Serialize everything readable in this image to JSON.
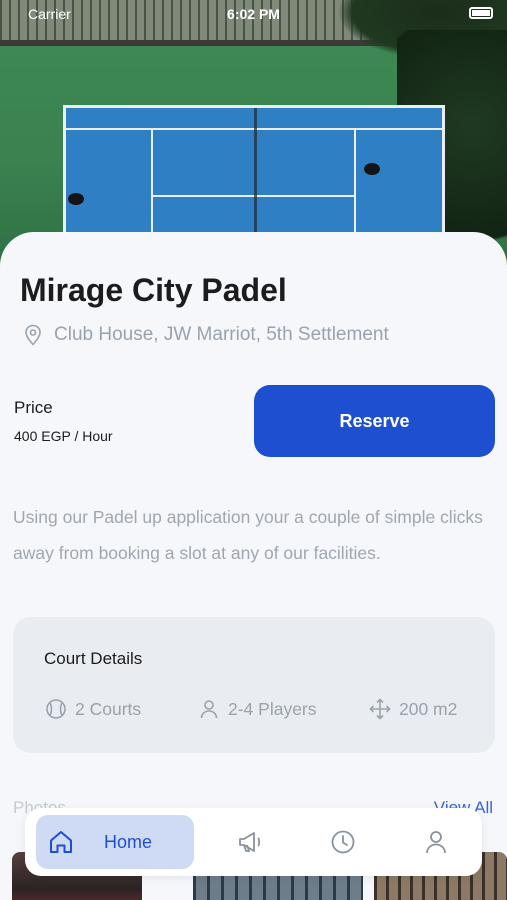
{
  "status_bar": {
    "carrier": "Carrier",
    "time": "6:02 PM"
  },
  "venue": {
    "name": "Mirage City Padel",
    "location": "Club House, JW Marriot, 5th Settlement"
  },
  "pricing": {
    "label": "Price",
    "value": "400 EGP / Hour"
  },
  "actions": {
    "reserve_label": "Reserve"
  },
  "description": "Using our Padel up application your a couple of simple clicks away from booking a slot at any of our facilities.",
  "court_details": {
    "title": "Court Details",
    "courts": "2 Courts",
    "players": "2-4 Players",
    "area": "200 m2"
  },
  "photos": {
    "label": "Photos",
    "view_all": "View All"
  },
  "nav": {
    "home_label": "Home",
    "active": "home"
  },
  "colors": {
    "accent": "#1e4fd1",
    "muted_text": "#9aa3ad",
    "card_bg": "#e9ecf0"
  },
  "icons": [
    "location-pin-icon",
    "tennis-ball-icon",
    "user-icon",
    "move-arrows-icon",
    "home-icon",
    "megaphone-icon",
    "clock-icon",
    "profile-icon"
  ]
}
